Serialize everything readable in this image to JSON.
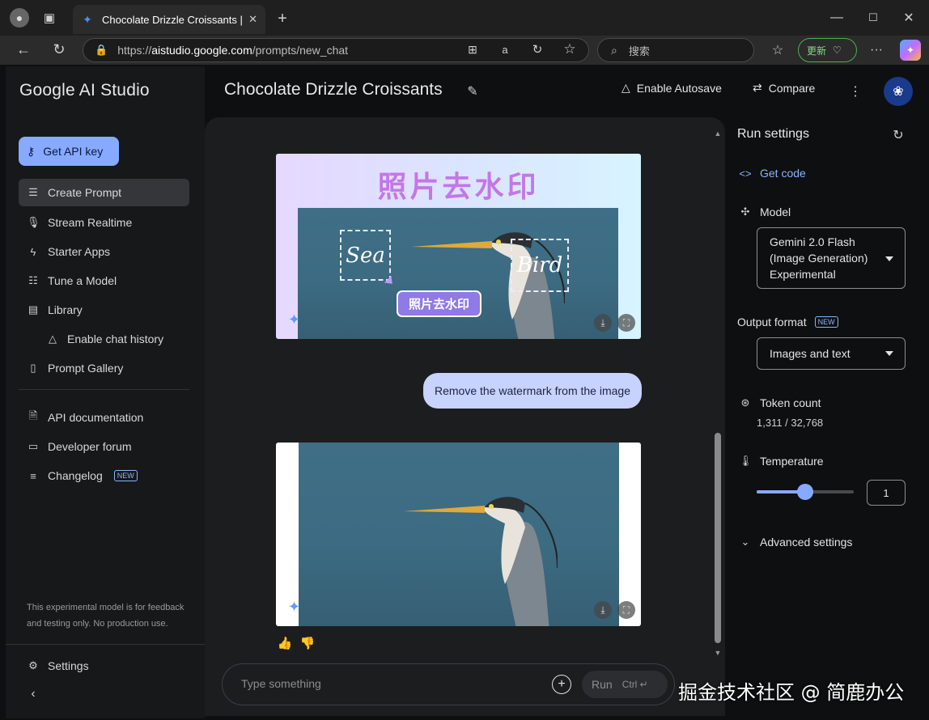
{
  "browser": {
    "tab_title": "Chocolate Drizzle Croissants | Goo",
    "url_prefix": "https://",
    "url_host": "aistudio.google.com",
    "url_path": "/prompts/new_chat",
    "search_placeholder": "搜索",
    "update_label": "更新"
  },
  "sidebar": {
    "brand": "Google AI Studio",
    "api_key_label": "Get API key",
    "items": [
      {
        "label": "Create Prompt",
        "icon": "create-prompt-icon"
      },
      {
        "label": "Stream Realtime",
        "icon": "mic-icon"
      },
      {
        "label": "Starter Apps",
        "icon": "bolt-icon"
      },
      {
        "label": "Tune a Model",
        "icon": "tune-icon"
      },
      {
        "label": "Library",
        "icon": "library-icon"
      },
      {
        "label": "Enable chat history",
        "icon": "drive-icon"
      },
      {
        "label": "Prompt Gallery",
        "icon": "book-icon"
      }
    ],
    "secondary": [
      {
        "label": "API documentation",
        "icon": "doc-search-icon"
      },
      {
        "label": "Developer forum",
        "icon": "forum-icon"
      },
      {
        "label": "Changelog",
        "icon": "changelog-icon",
        "badge": "NEW"
      }
    ],
    "disclaimer": "This experimental model is for feedback and testing only. No production use.",
    "settings_label": "Settings"
  },
  "header": {
    "title": "Chocolate Drizzle Croissants",
    "autosave_label": "Enable Autosave",
    "compare_label": "Compare"
  },
  "chat": {
    "first_image": {
      "headline": "照片去水印",
      "box_left": "Sea",
      "box_right": "Bird",
      "pill": "照片去水印"
    },
    "user_message": "Remove the watermark from the image",
    "input_placeholder": "Type something",
    "run_label": "Run",
    "run_shortcut": "Ctrl ↵"
  },
  "run_settings": {
    "title": "Run settings",
    "get_code_label": "Get code",
    "model_label": "Model",
    "model_value_1": "Gemini 2.0 Flash",
    "model_value_2": "(Image Generation)",
    "model_value_3": "Experimental",
    "output_format_label": "Output format",
    "output_format_badge": "NEW",
    "output_format_value": "Images and text",
    "token_count_label": "Token count",
    "token_count_value": "1,311 / 32,768",
    "temperature_label": "Temperature",
    "temperature_value": "1",
    "temperature_fraction": 0.5,
    "advanced_label": "Advanced settings"
  },
  "overlay": {
    "watermark_text": "掘金技术社区 @ 简鹿办公"
  },
  "colors": {
    "accent": "#87a9ff",
    "user_bubble": "#c7d2fe",
    "headline_purple": "#c477e8"
  }
}
